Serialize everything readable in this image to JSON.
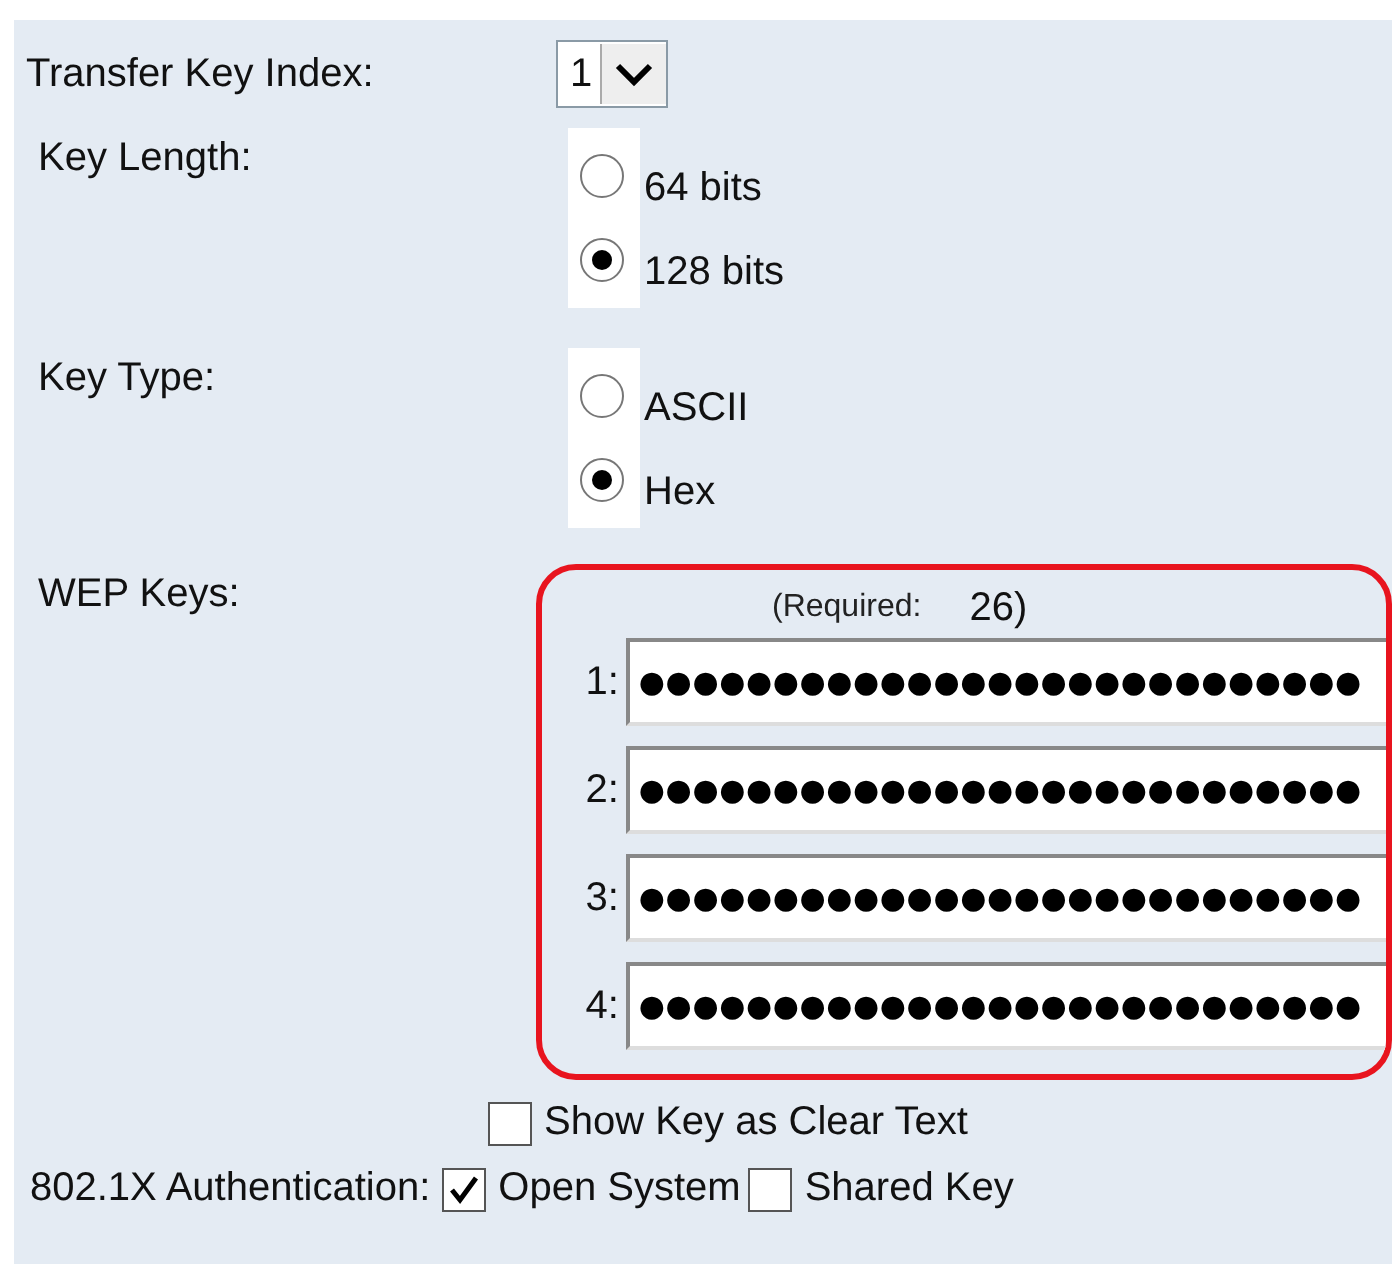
{
  "transfer_key_index": {
    "label": "Transfer Key Index:",
    "value": "1"
  },
  "key_length": {
    "label": "Key Length:",
    "options": [
      {
        "label": "64 bits",
        "selected": false
      },
      {
        "label": "128 bits",
        "selected": true
      }
    ]
  },
  "key_type": {
    "label": "Key Type:",
    "options": [
      {
        "label": "ASCII",
        "selected": false
      },
      {
        "label": "Hex",
        "selected": true
      }
    ]
  },
  "wep_keys": {
    "label": "WEP Keys:",
    "required_label": "(Required:",
    "required_value": "26)",
    "keys": [
      {
        "number": "1:",
        "value": "●●●●●●●●●●●●●●●●●●●●●●●●●●●"
      },
      {
        "number": "2:",
        "value": "●●●●●●●●●●●●●●●●●●●●●●●●●●●"
      },
      {
        "number": "3:",
        "value": "●●●●●●●●●●●●●●●●●●●●●●●●●●●"
      },
      {
        "number": "4:",
        "value": "●●●●●●●●●●●●●●●●●●●●●●●●●●●"
      }
    ]
  },
  "show_key": {
    "label": "Show Key as Clear Text",
    "checked": false
  },
  "authentication": {
    "label": "802.1X Authentication:",
    "options": [
      {
        "label": "Open System",
        "checked": true
      },
      {
        "label": "Shared Key",
        "checked": false
      }
    ]
  }
}
